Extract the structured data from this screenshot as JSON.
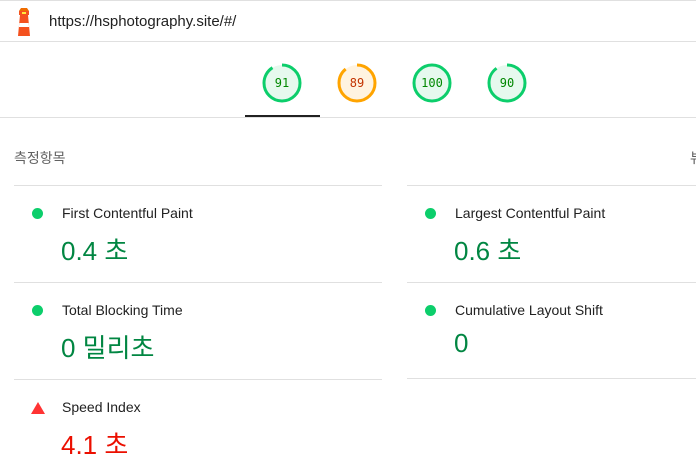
{
  "header": {
    "url": "https://hsphotography.site/#/"
  },
  "gauges": [
    {
      "score": "91",
      "color": "#0cce6b",
      "text_color": "#008800",
      "fraction": 0.91
    },
    {
      "score": "89",
      "color": "#ffa400",
      "text_color": "#c33300",
      "fraction": 0.89
    },
    {
      "score": "100",
      "color": "#0cce6b",
      "text_color": "#008800",
      "fraction": 1.0
    },
    {
      "score": "90",
      "color": "#0cce6b",
      "text_color": "#008800",
      "fraction": 0.9
    }
  ],
  "metrics": {
    "section_title": "측정항목",
    "section_right_glyph": "뷰",
    "fcp": {
      "label": "First Contentful Paint",
      "value": "0.4 초",
      "status": "pass-icon"
    },
    "lcp": {
      "label": "Largest Contentful Paint",
      "value": "0.6 초",
      "status": "pass-icon"
    },
    "tbt": {
      "label": "Total Blocking Time",
      "value": "0 밀리초",
      "status": "pass-icon"
    },
    "cls": {
      "label": "Cumulative Layout Shift",
      "value": "0",
      "status": "pass-icon"
    },
    "si": {
      "label": "Speed Index",
      "value": "4.1 초",
      "status": "fail-icon"
    }
  },
  "colors": {
    "pass": "#0cce6b",
    "pass_text": "#018642",
    "fail": "#ff3333",
    "fail_text": "#eb0f00",
    "average": "#ffa400"
  }
}
